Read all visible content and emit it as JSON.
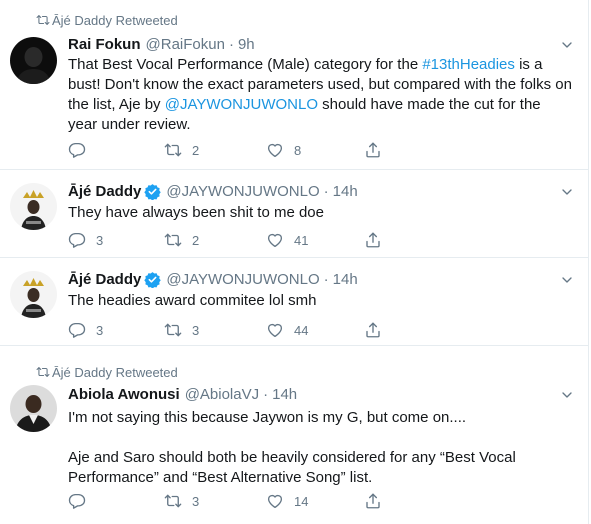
{
  "colors": {
    "accent": "#1b95e0",
    "muted": "#657786",
    "text": "#14171a",
    "divider": "#e6ecf0"
  },
  "tweets": [
    {
      "retweeted_by": "Ājé Daddy Retweeted",
      "name": "Rai Fokun",
      "handle": "@RaiFokun",
      "dot": "·",
      "time": "9h",
      "text_parts": [
        "That Best Vocal Performance (Male) category for the ",
        "#13thHeadies",
        " is a bust! Don't know the exact parameters used, but compared with the folks on the list, Aje by ",
        "@JAYWONJUWONLO",
        " should have made the cut for the year under review."
      ],
      "replies": "",
      "retweets": "2",
      "likes": "8"
    },
    {
      "name": "Ājé Daddy",
      "handle": "@JAYWONJUWONLO",
      "dot": "·",
      "time": "14h",
      "text": "They have always been shit to me doe",
      "replies": "3",
      "retweets": "2",
      "likes": "41"
    },
    {
      "name": "Ājé Daddy",
      "handle": "@JAYWONJUWONLO",
      "dot": "·",
      "time": "14h",
      "text": "The headies award commitee lol smh",
      "replies": "3",
      "retweets": "3",
      "likes": "44"
    },
    {
      "retweeted_by": "Ājé Daddy Retweeted",
      "name": "Abiola Awonusi",
      "handle": "@AbiolaVJ",
      "dot": "·",
      "time": "14h",
      "text_lines": [
        "I'm not saying this because Jaywon is my G, but come on....",
        "Aje and Saro should both be heavily considered for any “Best Vocal Performance” and “Best Alternative Song” list."
      ],
      "replies": "",
      "retweets": "3",
      "likes": "14"
    }
  ]
}
